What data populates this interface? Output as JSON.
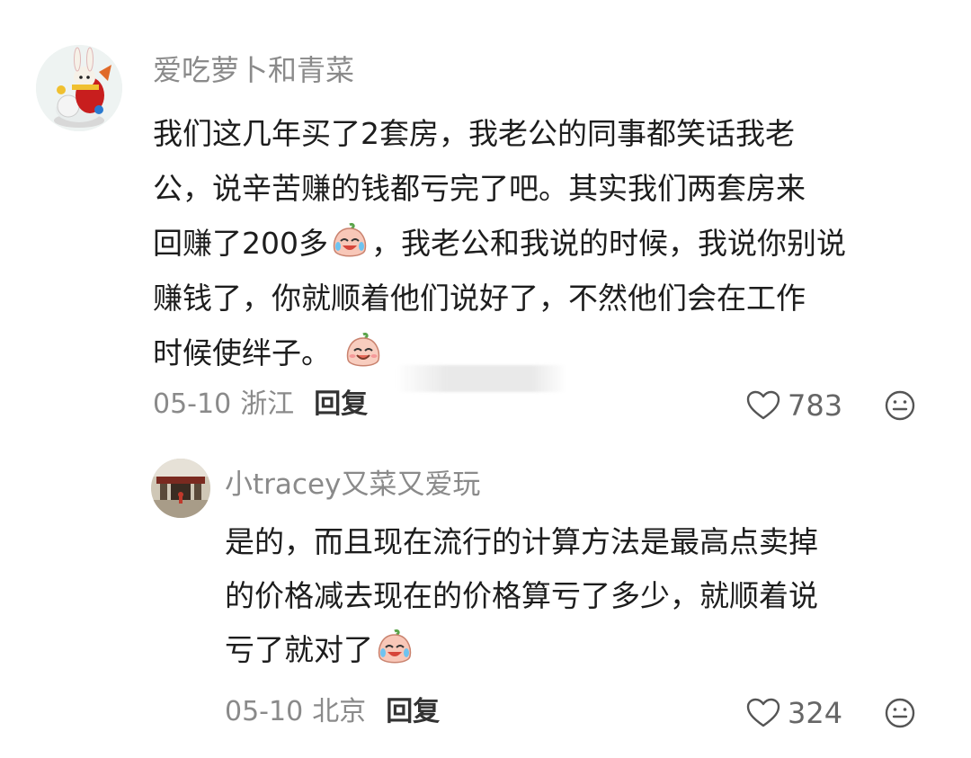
{
  "comment1": {
    "username": "爱吃萝卜和青菜",
    "lines": [
      "我们这几年买了2套房，我老公的同事都笑话我老",
      "公，说辛苦赚的钱都亏完了吧。其实我们两套房来",
      "回赚了200多",
      "，我老公和我说的时候，我说你别说",
      "赚钱了，你就顺着他们说好了，不然他们会在工作",
      "时候使绊子。"
    ],
    "date": "05-10",
    "location": "浙江",
    "reply_label": "回复",
    "likes": "783"
  },
  "comment2": {
    "username": "小tracey又菜又爱玩",
    "lines": [
      "是的，而且现在流行的计算方法是最高点卖掉",
      "的价格减去现在的价格算亏了多少，就顺着说",
      "亏了就对了"
    ],
    "date": "05-10",
    "location": "北京",
    "reply_label": "回复",
    "likes": "324"
  },
  "icons": {
    "like": "heart-outline-icon",
    "more": "smiley-icon",
    "emoji_laugh_cry": "laugh-cry-emoji",
    "emoji_smile": "smile-emoji"
  },
  "colors": {
    "username": "#8a8a8a",
    "text": "#1d1d1d",
    "meta": "#8a8a8a",
    "reply": "#333333"
  }
}
